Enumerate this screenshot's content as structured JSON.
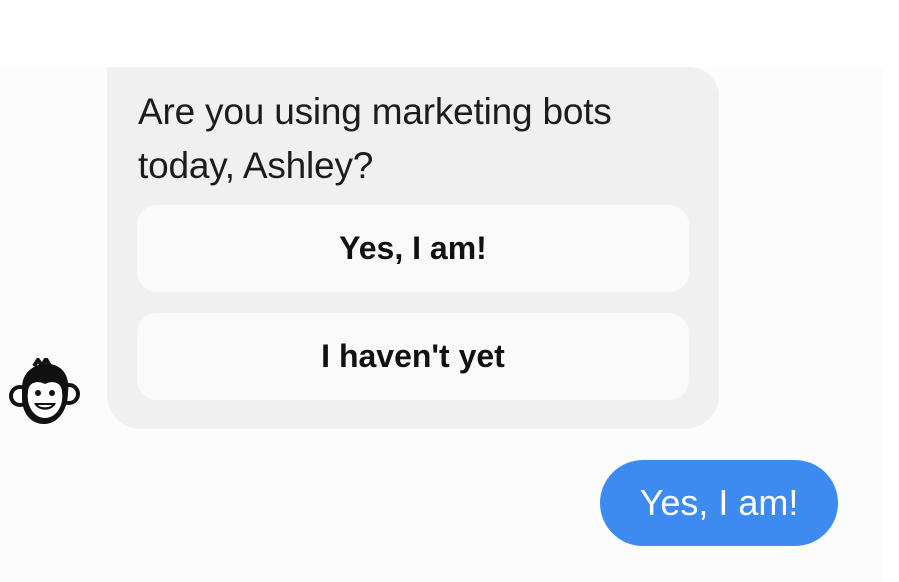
{
  "bot": {
    "avatar_icon": "monkey-mascot-icon",
    "message": "Are you using marketing bots today, Ashley?",
    "quick_replies": [
      {
        "label": "Yes, I am!"
      },
      {
        "label": "I haven't yet"
      }
    ]
  },
  "user": {
    "message": "Yes, I am!"
  },
  "colors": {
    "bot_bubble": "#f0f0f0",
    "quick_reply_bg": "#fafafa",
    "user_bubble": "#3d8af0",
    "user_text": "#ffffff"
  }
}
